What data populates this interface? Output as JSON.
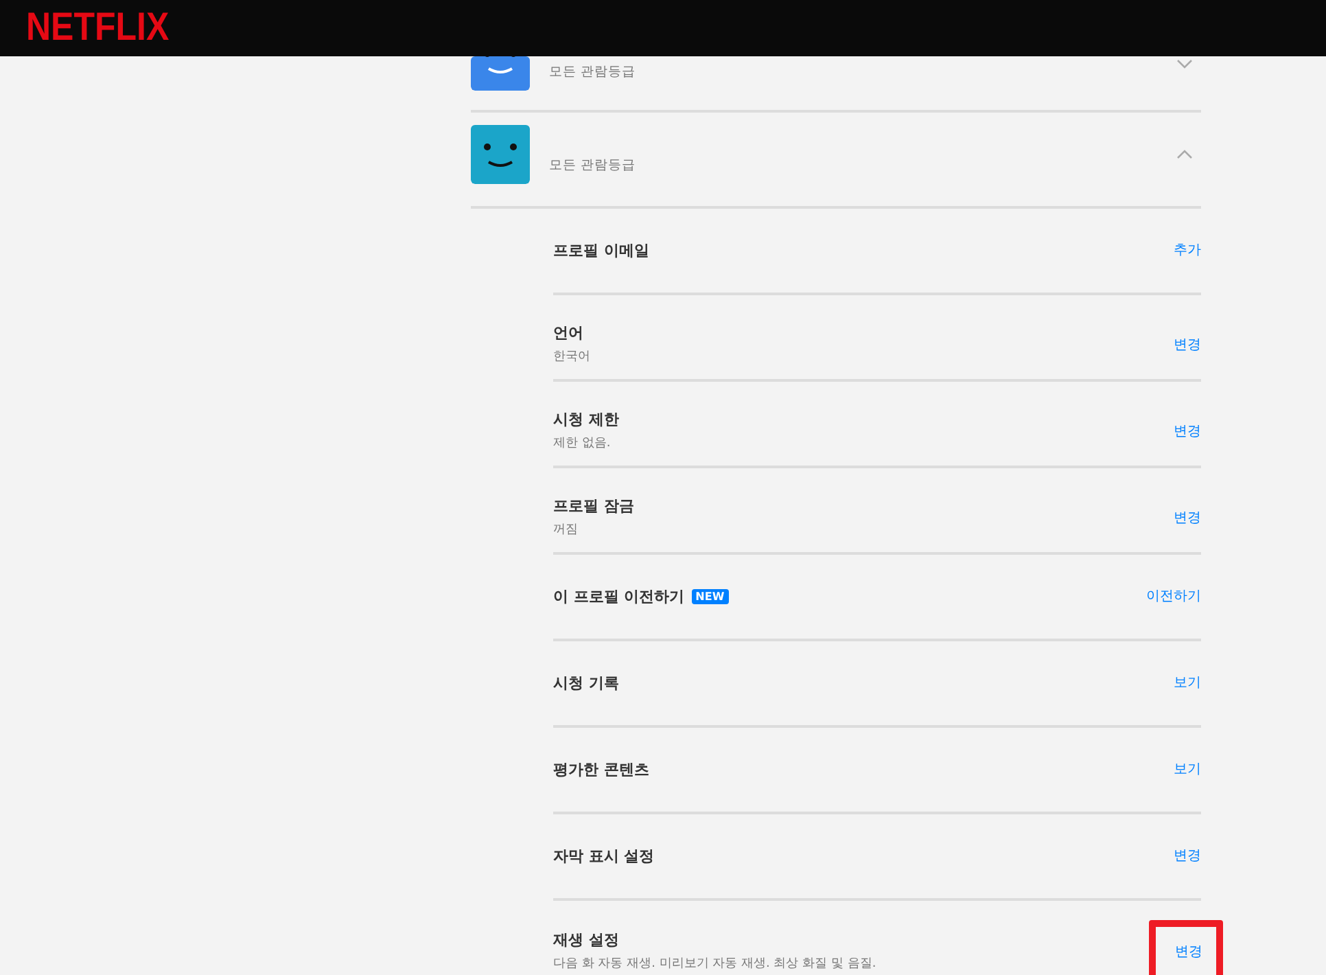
{
  "header": {
    "logo": "NETFLIX"
  },
  "profiles": [
    {
      "rating": "모든 관람등급",
      "expanded": false,
      "color": "#3a86ea"
    },
    {
      "rating": "모든 관람등급",
      "expanded": true,
      "color": "#1ba5c9"
    }
  ],
  "settings": [
    {
      "label": "프로필 이메일",
      "action": "추가",
      "highlighted": false
    },
    {
      "label": "언어",
      "detail": "한국어",
      "action": "변경",
      "highlighted": false
    },
    {
      "label": "시청 제한",
      "detail": "제한 없음.",
      "action": "변경",
      "highlighted": false
    },
    {
      "label": "프로필 잠금",
      "detail": "꺼짐",
      "action": "변경",
      "highlighted": false
    },
    {
      "label": "이 프로필 이전하기",
      "badge": "NEW",
      "action": "이전하기",
      "highlighted": false
    },
    {
      "label": "시청 기록",
      "action": "보기",
      "highlighted": false
    },
    {
      "label": "평가한 콘텐츠",
      "action": "보기",
      "highlighted": false
    },
    {
      "label": "자막 표시 설정",
      "action": "변경",
      "highlighted": false
    },
    {
      "label": "재생 설정",
      "detail": "다음 화 자동 재생. 미리보기 자동 재생. 최상 화질 및 음질.",
      "action": "변경",
      "highlighted": true
    }
  ]
}
